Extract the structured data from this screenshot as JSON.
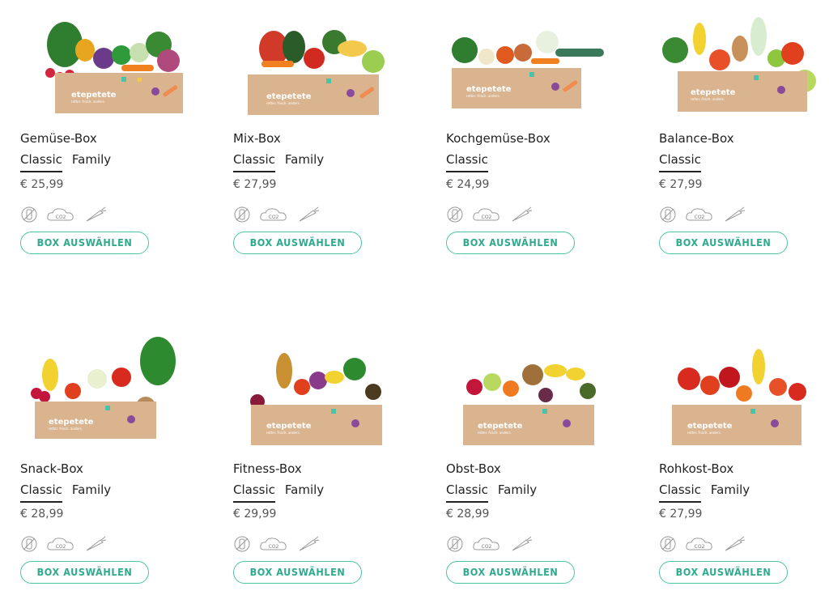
{
  "brand": "etepetete",
  "tagline": "retter. frisch. anders.",
  "button_label": "BOX AUSWÄHLEN",
  "eco_icons": [
    "no-plastic-icon",
    "co2-cloud-icon",
    "carrot-icon"
  ],
  "co2_label": "CO2",
  "colors": {
    "accent": "#4cc3a7",
    "box": "#d9b48f",
    "text": "#222222"
  },
  "products": [
    {
      "name": "Gemüse-Box",
      "variants": [
        "Classic",
        "Family"
      ],
      "active_variant": "Classic",
      "price": "€ 25,99"
    },
    {
      "name": "Mix-Box",
      "variants": [
        "Classic",
        "Family"
      ],
      "active_variant": "Classic",
      "price": "€ 27,99"
    },
    {
      "name": "Kochgemüse-Box",
      "variants": [
        "Classic"
      ],
      "active_variant": "Classic",
      "price": "€ 24,99"
    },
    {
      "name": "Balance-Box",
      "variants": [
        "Classic"
      ],
      "active_variant": "Classic",
      "price": "€ 27,99"
    },
    {
      "name": "Snack-Box",
      "variants": [
        "Classic",
        "Family"
      ],
      "active_variant": "Classic",
      "price": "€ 28,99"
    },
    {
      "name": "Fitness-Box",
      "variants": [
        "Classic",
        "Family"
      ],
      "active_variant": "Classic",
      "price": "€ 29,99"
    },
    {
      "name": "Obst-Box",
      "variants": [
        "Classic",
        "Family"
      ],
      "active_variant": "Classic",
      "price": "€ 28,99"
    },
    {
      "name": "Rohkost-Box",
      "variants": [
        "Classic",
        "Family"
      ],
      "active_variant": "Classic",
      "price": "€ 27,99"
    }
  ]
}
